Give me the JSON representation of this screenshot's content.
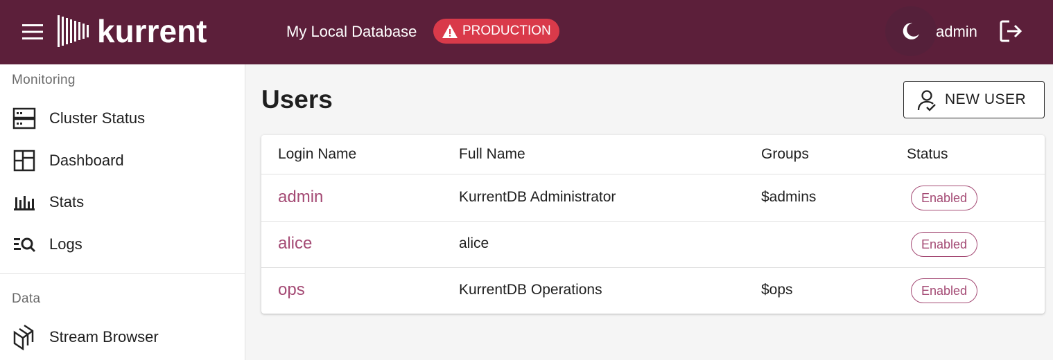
{
  "header": {
    "brand": "kurrent",
    "database_name": "My Local Database",
    "environment_badge": "PRODUCTION",
    "username": "admin",
    "colors": {
      "bar": "#5c1f3a",
      "badge": "#d93a4a"
    }
  },
  "sidebar": {
    "sections": [
      {
        "title": "Monitoring",
        "items": [
          {
            "label": "Cluster Status",
            "icon": "server-icon"
          },
          {
            "label": "Dashboard",
            "icon": "dashboard-icon"
          },
          {
            "label": "Stats",
            "icon": "bar-chart-icon"
          },
          {
            "label": "Logs",
            "icon": "log-search-icon"
          }
        ]
      },
      {
        "title": "Data",
        "items": [
          {
            "label": "Stream Browser",
            "icon": "stream-stack-icon"
          }
        ]
      }
    ]
  },
  "main": {
    "title": "Users",
    "new_user_label": "NEW USER",
    "table": {
      "columns": [
        "Login Name",
        "Full Name",
        "Groups",
        "Status"
      ],
      "rows": [
        {
          "login": "admin",
          "full_name": "KurrentDB Administrator",
          "groups": "$admins",
          "status": "Enabled"
        },
        {
          "login": "alice",
          "full_name": "alice",
          "groups": "",
          "status": "Enabled"
        },
        {
          "login": "ops",
          "full_name": "KurrentDB Operations",
          "groups": "$ops",
          "status": "Enabled"
        }
      ]
    },
    "colors": {
      "accent": "#a44a74"
    }
  }
}
